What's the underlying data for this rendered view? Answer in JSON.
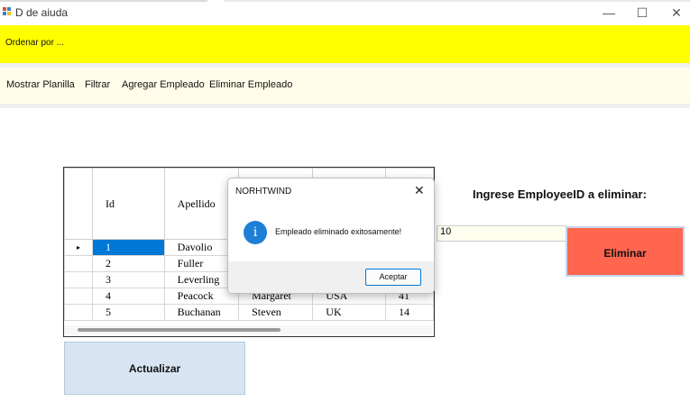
{
  "window": {
    "title": "D de aiuda",
    "controls": {
      "minimize": "—",
      "maximize": "☐",
      "close": "✕"
    }
  },
  "order_bar": {
    "label": "Ordenar por ..."
  },
  "menu": {
    "items": [
      {
        "label": "Mostrar  Planilla"
      },
      {
        "label": "Filtrar"
      },
      {
        "label": "Agregar Empleado"
      },
      {
        "label": "Eliminar Empleado"
      }
    ]
  },
  "grid": {
    "columns": [
      "Id",
      "Apellido",
      "",
      "",
      ""
    ],
    "row_indicator": "▸",
    "rows": [
      {
        "id": "1",
        "apellido": "Davolio",
        "nombre": "",
        "pais": "",
        "extra": ""
      },
      {
        "id": "2",
        "apellido": "Fuller",
        "nombre": "",
        "pais": "",
        "extra": ""
      },
      {
        "id": "3",
        "apellido": "Leverling",
        "nombre": "",
        "pais": "",
        "extra": ""
      },
      {
        "id": "4",
        "apellido": "Peacock",
        "nombre": "Margaret",
        "pais": "USA",
        "extra": "41"
      },
      {
        "id": "5",
        "apellido": "Buchanan",
        "nombre": "Steven",
        "pais": "UK",
        "extra": "14"
      }
    ],
    "selected_row_index": 0
  },
  "delete_panel": {
    "label": "Ingrese EmployeeID a eliminar:",
    "input_value": "10",
    "button_label": "Eliminar"
  },
  "refresh": {
    "button_label": "Actualizar"
  },
  "dialog": {
    "title": "NORHTWIND",
    "close": "✕",
    "icon": "i",
    "message": "Empleado eliminado exitosamente!",
    "accept_label": "Aceptar"
  },
  "colors": {
    "order_bar": "#ffff00",
    "menu_bar": "#fffde9",
    "delete_button": "#ff6650",
    "refresh_button": "#d8e4f1",
    "selection": "#0078d7",
    "info_icon": "#1e7fd6"
  }
}
